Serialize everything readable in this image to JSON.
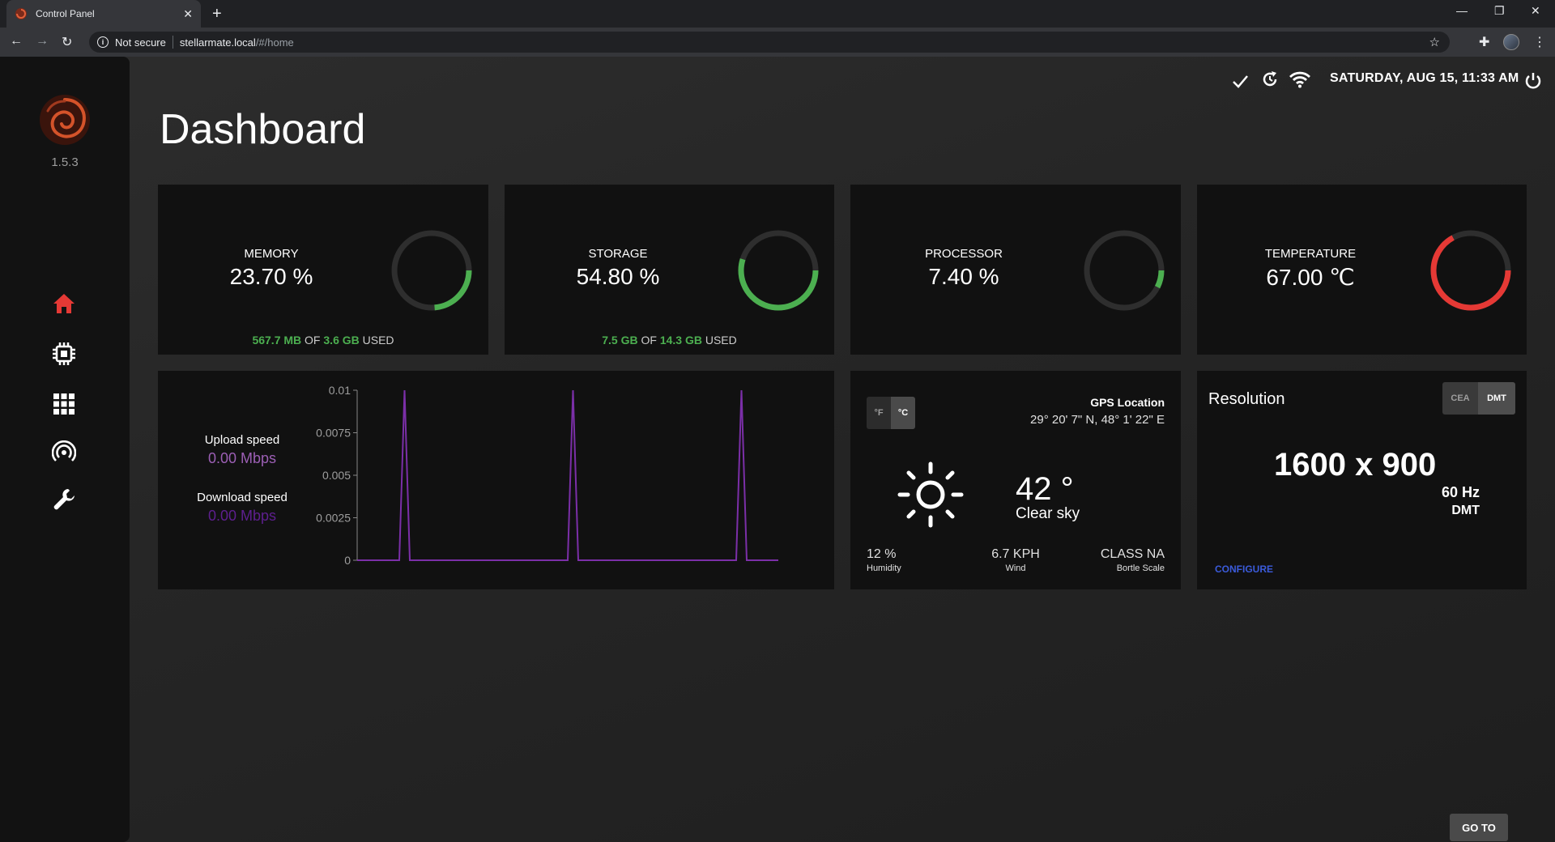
{
  "browser": {
    "tab_title": "Control Panel",
    "tab_close": "✕",
    "new_tab": "+",
    "not_secure": "Not secure",
    "url_host": "stellarmate.local",
    "url_path": "/#/home"
  },
  "sidebar": {
    "version": "1.5.3",
    "items": [
      {
        "icon": "home-icon",
        "active": true
      },
      {
        "icon": "processor-icon"
      },
      {
        "icon": "apps-grid-icon"
      },
      {
        "icon": "broadcast-icon"
      },
      {
        "icon": "wrench-icon"
      }
    ]
  },
  "header": {
    "datetime": "SATURDAY, AUG 15, 11:33 AM"
  },
  "page": {
    "title": "Dashboard"
  },
  "stats": {
    "memory": {
      "label": "MEMORY",
      "value": "23.70 %",
      "percent": 23.7,
      "used": "567.7 MB",
      "of": "OF",
      "total": "3.6 GB",
      "suffix": "USED",
      "color": "#4caf50"
    },
    "storage": {
      "label": "STORAGE",
      "value": "54.80 %",
      "percent": 54.8,
      "used": "7.5 GB",
      "of": "OF",
      "total": "14.3 GB",
      "suffix": "USED",
      "color": "#4caf50"
    },
    "processor": {
      "label": "PROCESSOR",
      "value": "7.40 %",
      "percent": 7.4,
      "color": "#4caf50"
    },
    "temperature": {
      "label": "TEMPERATURE",
      "value": "67.00 ℃",
      "percent": 67.0,
      "color": "#e53935"
    }
  },
  "network": {
    "upload_label": "Upload speed",
    "upload_value": "0.00 Mbps",
    "upload_color": "#9c5fb5",
    "download_label": "Download speed",
    "download_value": "0.00 Mbps",
    "download_color": "#5e1f8f"
  },
  "chart_data": {
    "type": "line",
    "x": [
      0,
      8,
      9,
      10,
      40,
      41,
      42,
      72,
      73,
      74,
      80
    ],
    "series": [
      {
        "values": [
          0,
          0,
          0.01,
          0,
          0,
          0.01,
          0,
          0,
          0.01,
          0,
          0
        ]
      }
    ],
    "yticks": [
      "0.01",
      "0.0075",
      "0.005",
      "0.0025",
      "0"
    ],
    "ylim": [
      0,
      0.01
    ],
    "line_color": "#7b2fa8"
  },
  "weather": {
    "unit_f": "°F",
    "unit_c": "°C",
    "gps_label": "GPS Location",
    "gps_value": "29° 20' 7\" N, 48° 1' 22\" E",
    "temp": "42 °",
    "condition": "Clear sky",
    "humidity_value": "12 %",
    "humidity_label": "Humidity",
    "wind_value": "6.7 KPH",
    "wind_label": "Wind",
    "bortle_value": "CLASS NA",
    "bortle_label": "Bortle Scale"
  },
  "resolution": {
    "title": "Resolution",
    "mode_cea": "CEA",
    "mode_dmt": "DMT",
    "value": "1600 x 900",
    "refresh": "60 Hz",
    "standard": "DMT",
    "configure": "CONFIGURE"
  },
  "footer": {
    "goto": "GO TO"
  }
}
